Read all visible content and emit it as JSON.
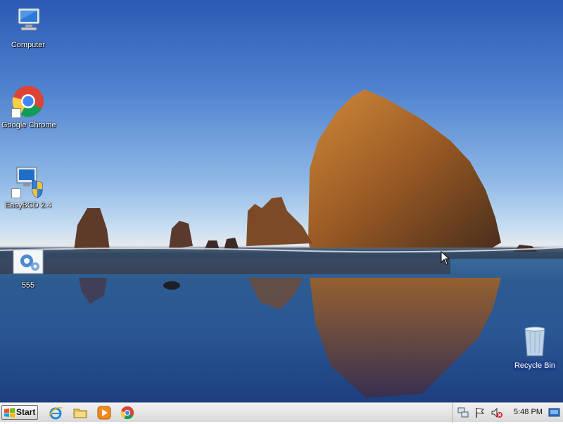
{
  "desktop": {
    "icons": [
      {
        "label": "Computer",
        "icon": "computer-icon"
      },
      {
        "label": "Google Chrome",
        "icon": "chrome-icon"
      },
      {
        "label": "EasyBCD 2.4",
        "icon": "easybcd-icon"
      },
      {
        "label": "555",
        "icon": "gear-settings-icon"
      },
      {
        "label": "Recycle Bin",
        "icon": "recycle-bin-icon"
      }
    ]
  },
  "taskbar": {
    "start_label": "Start",
    "quick_launch": [
      "internet-explorer-icon",
      "file-explorer-icon",
      "media-player-icon",
      "chrome-icon"
    ],
    "tray_icons": [
      "network-icon",
      "action-center-flag-icon",
      "volume-muted-icon"
    ],
    "clock": "5:48 PM"
  }
}
